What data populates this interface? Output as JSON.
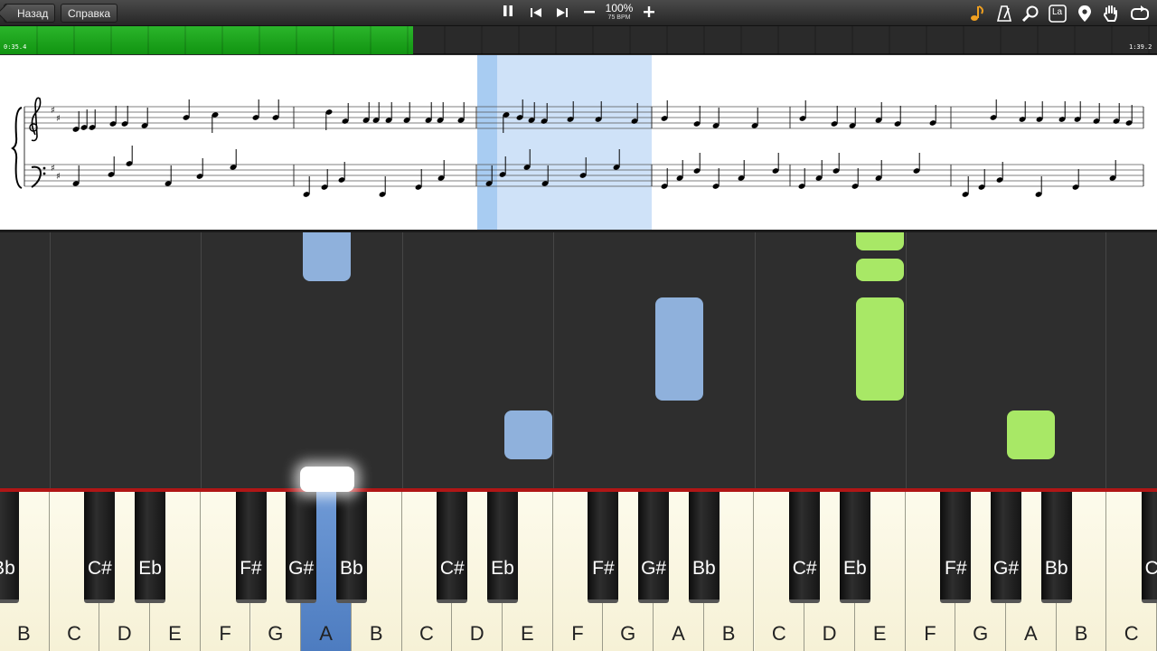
{
  "toolbar": {
    "back_label": "Назад",
    "help_label": "Справка",
    "speed_percent": "100%",
    "speed_bpm": "75 BPM",
    "left_controls": [
      {
        "name": "pause-button",
        "icon": "pause-icon",
        "glyph": "❚❚"
      },
      {
        "name": "previous-button",
        "icon": "skip-back-icon",
        "glyph": "⏮"
      },
      {
        "name": "next-button",
        "icon": "skip-forward-icon",
        "glyph": "⏭"
      },
      {
        "name": "slower-button",
        "icon": "minus-icon",
        "glyph": "−"
      },
      {
        "name": "faster-button",
        "icon": "plus-icon",
        "glyph": "+"
      }
    ],
    "right_icons": [
      "note-icon",
      "metronome-icon",
      "zoom-icon",
      "note-name-icon",
      "location-pin-icon",
      "hand-icon",
      "loop-icon"
    ],
    "note_name_label": "La",
    "accent_color": "#f0a020"
  },
  "progress": {
    "elapsed": "0:35.4",
    "total": "1:39.2",
    "fraction": 0.357,
    "color": "#22aa22"
  },
  "keyboard": {
    "white_keys": [
      "B",
      "C",
      "D",
      "E",
      "F",
      "G",
      "A",
      "B",
      "C",
      "D",
      "E",
      "F",
      "G",
      "A",
      "B",
      "C",
      "D",
      "E",
      "F",
      "G",
      "A",
      "B",
      "C"
    ],
    "black_keys": [
      "Bb",
      "C#",
      "Eb",
      "F#",
      "G#",
      "Bb",
      "C#",
      "Eb",
      "F#",
      "G#",
      "Bb",
      "C#",
      "Eb",
      "F#",
      "G#",
      "Bb",
      "C#"
    ],
    "active_key": "A",
    "active_color": "#5a88c8"
  },
  "falling_notes": {
    "left_hand_color": "#8fb1dc",
    "right_hand_color": "#a8e866"
  }
}
